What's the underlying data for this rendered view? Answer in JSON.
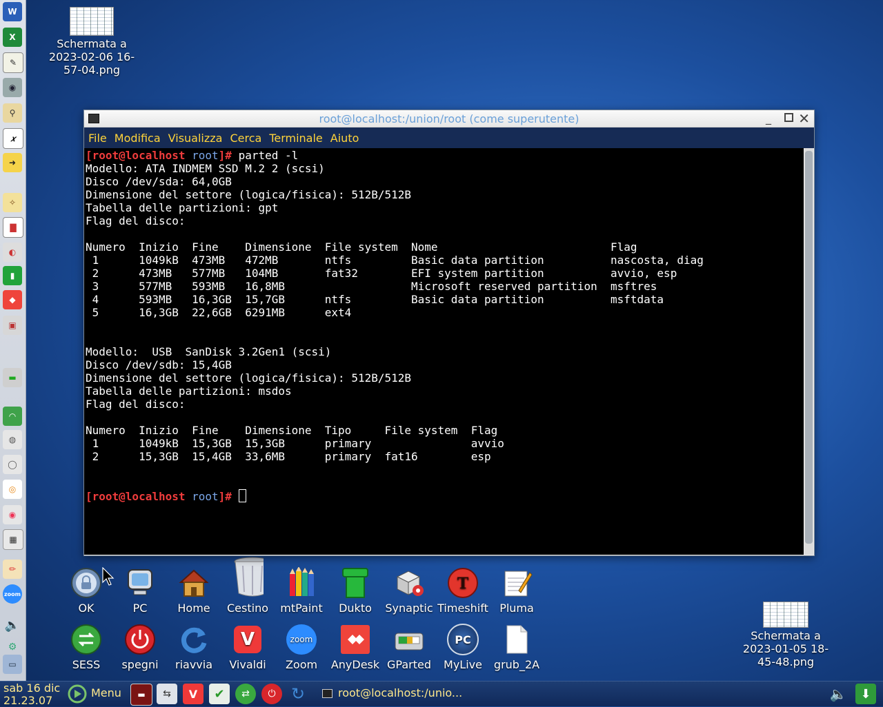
{
  "desktop": {
    "file1": {
      "line1": "Schermata a",
      "line2": "2023-02-06 16-",
      "line3": "57-04.png"
    },
    "file2": {
      "line1": "Schermata a",
      "line2": "2023-01-05 18-",
      "line3": "45-48.png"
    }
  },
  "dock_row1": [
    "OK",
    "PC",
    "Home",
    "Cestino",
    "mtPaint",
    "Dukto",
    "Synaptic",
    "Timeshift",
    "Pluma"
  ],
  "dock_row2": [
    "SESS",
    "spegni",
    "riavvia",
    "Vivaldi",
    "Zoom",
    "AnyDesk",
    "GParted",
    "MyLive",
    "grub_2A"
  ],
  "icons": {
    "zoom_text": "zoom",
    "pc_text": "PC",
    "vivaldi_letter": "V"
  },
  "terminal": {
    "title": "root@localhost:/union/root (come superutente)",
    "menu": [
      "File",
      "Modifica",
      "Visualizza",
      "Cerca",
      "Terminale",
      "Aiuto"
    ],
    "prompt_user": "[root@localhost",
    "prompt_dir": "root",
    "prompt_end": "]#",
    "command": " parted -l",
    "sda_info": [
      "Modello: ATA INDMEM SSD M.2 2 (scsi)",
      "Disco /dev/sda: 64,0GB",
      "Dimensione del settore (logica/fisica): 512B/512B",
      "Tabella delle partizioni: gpt",
      "Flag del disco:"
    ],
    "sda_header": "Numero  Inizio  Fine    Dimensione  File system  Nome                          Flag",
    "sda_rows": [
      " 1      1049kB  473MB   472MB       ntfs         Basic data partition          nascosta, diag",
      " 2      473MB   577MB   104MB       fat32        EFI system partition          avvio, esp",
      " 3      577MB   593MB   16,8MB                   Microsoft reserved partition  msftres",
      " 4      593MB   16,3GB  15,7GB      ntfs         Basic data partition          msftdata",
      " 5      16,3GB  22,6GB  6291MB      ext4"
    ],
    "sdb_info": [
      "Modello:  USB  SanDisk 3.2Gen1 (scsi)",
      "Disco /dev/sdb: 15,4GB",
      "Dimensione del settore (logica/fisica): 512B/512B",
      "Tabella delle partizioni: msdos",
      "Flag del disco:"
    ],
    "sdb_header": "Numero  Inizio  Fine    Dimensione  Tipo     File system  Flag",
    "sdb_rows": [
      " 1      1049kB  15,3GB  15,3GB      primary               avvio",
      " 2      15,3GB  15,4GB  33,6MB      primary  fat16        esp"
    ]
  },
  "taskbar": {
    "date": "sab 16 dic",
    "time": "21.23.07",
    "menu_label": "Menu",
    "task_label": "root@localhost:/unio..."
  },
  "colors": {
    "menu_text": "#ffd33a",
    "prompt_red": "#ef3c3c",
    "prompt_blue": "#7aa6e8",
    "title_text": "#6aa0d8"
  }
}
